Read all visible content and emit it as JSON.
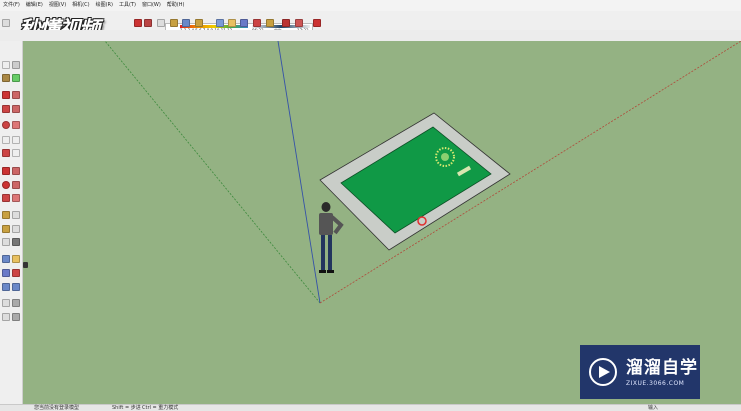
{
  "menubar": {
    "items": [
      "文件(F)",
      "编辑(E)",
      "视图(V)",
      "相机(C)",
      "绘图(R)",
      "工具(T)",
      "窗口(W)",
      "帮助(H)"
    ]
  },
  "toolbar": {
    "shadow_months": "1 2 3 4 5 6 7 8 9 10 11 12",
    "shadow_time_start": "06:33",
    "shadow_time_mid": "中午",
    "shadow_time_end": "17:33"
  },
  "logo": {
    "text": "秒懂视频"
  },
  "viewport": {
    "background_color": "#94b283",
    "model_description_none": ""
  },
  "watermark": {
    "title": "溜溜自学",
    "url": "ZIXUE.3066.COM"
  },
  "statusbar": {
    "hint": "您当前没有登录模型",
    "mode": "Shift = 步进",
    "mode2": "Ctrl = 重力模式",
    "measurements_label": "输入"
  },
  "icons": {
    "logo": "play-icon",
    "watermark": "play-triangle-icon"
  }
}
